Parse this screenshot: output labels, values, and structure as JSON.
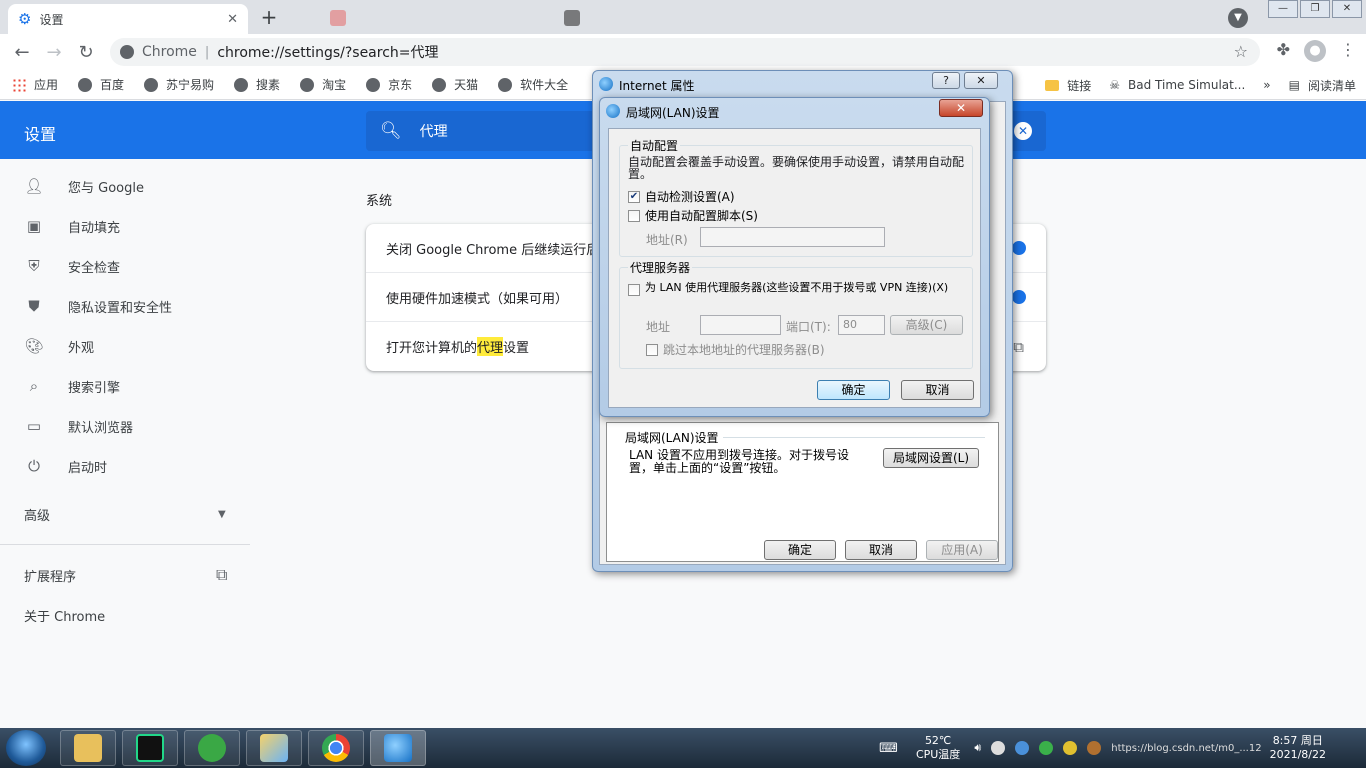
{
  "browser": {
    "active_tab_title": "设置",
    "bg_tabs": [
      "",
      "",
      ""
    ],
    "omnibox_host": "Chrome",
    "omnibox_url": "chrome://settings/?search=代理",
    "bookmarks": [
      "应用",
      "百度",
      "苏宁易购",
      "搜素",
      "淘宝",
      "京东",
      "天猫",
      "软件大全"
    ],
    "bookmarks_right": {
      "folder": "链接",
      "game": "Bad Time Simulat...",
      "overflow": "»",
      "reading_list": "阅读清单"
    }
  },
  "settings": {
    "header_title": "设置",
    "search_value": "代理",
    "sidebar": [
      {
        "label": "您与 Google",
        "icon": "person-icon"
      },
      {
        "label": "自动填充",
        "icon": "clipboard-icon"
      },
      {
        "label": "安全检查",
        "icon": "shield-check-icon"
      },
      {
        "label": "隐私设置和安全性",
        "icon": "shield-icon"
      },
      {
        "label": "外观",
        "icon": "palette-icon"
      },
      {
        "label": "搜索引擎",
        "icon": "search-icon"
      },
      {
        "label": "默认浏览器",
        "icon": "browser-icon"
      },
      {
        "label": "启动时",
        "icon": "power-icon"
      }
    ],
    "advanced": "高级",
    "extensions": "扩展程序",
    "about": "关于 Chrome",
    "section_title": "系统",
    "rows": {
      "row1": "关闭 Google Chrome 后继续运行后台",
      "row2": "使用硬件加速模式（如果可用）",
      "row3_pre": "打开您计算机的",
      "row3_hl": "代理",
      "row3_post": "设置"
    }
  },
  "inet_dialog": {
    "title": "Internet 属性",
    "help": "?",
    "lan_group_title": "局域网(LAN)设置",
    "lan_text": "LAN 设置不应用到拨号连接。对于拨号设置，单击上面的“设置”按钮。",
    "lan_button": "局域网设置(L)",
    "ok": "确定",
    "cancel": "取消",
    "apply": "应用(A)"
  },
  "lan_dialog": {
    "title": "局域网(LAN)设置",
    "auto_group": "自动配置",
    "auto_desc": "自动配置会覆盖手动设置。要确保使用手动设置，请禁用自动配置。",
    "auto_detect": "自动检测设置(A)",
    "auto_detect_checked": true,
    "use_script": "使用自动配置脚本(S)",
    "script_addr_label": "地址(R)",
    "proxy_group": "代理服务器",
    "use_proxy": "为 LAN 使用代理服务器(这些设置不用于拨号或 VPN 连接)(X)",
    "addr_label": "地址",
    "port_label": "端口(T):",
    "port_value": "80",
    "advanced_btn": "高级(C)",
    "bypass_local": "跳过本地地址的代理服务器(B)",
    "ok": "确定",
    "cancel": "取消"
  },
  "taskbar": {
    "temp": "52℃",
    "temp_label": "CPU温度",
    "time": "8:57 周日",
    "date": "2021/8/22",
    "watermark": "https://blog.csdn.net/m0_...12"
  }
}
